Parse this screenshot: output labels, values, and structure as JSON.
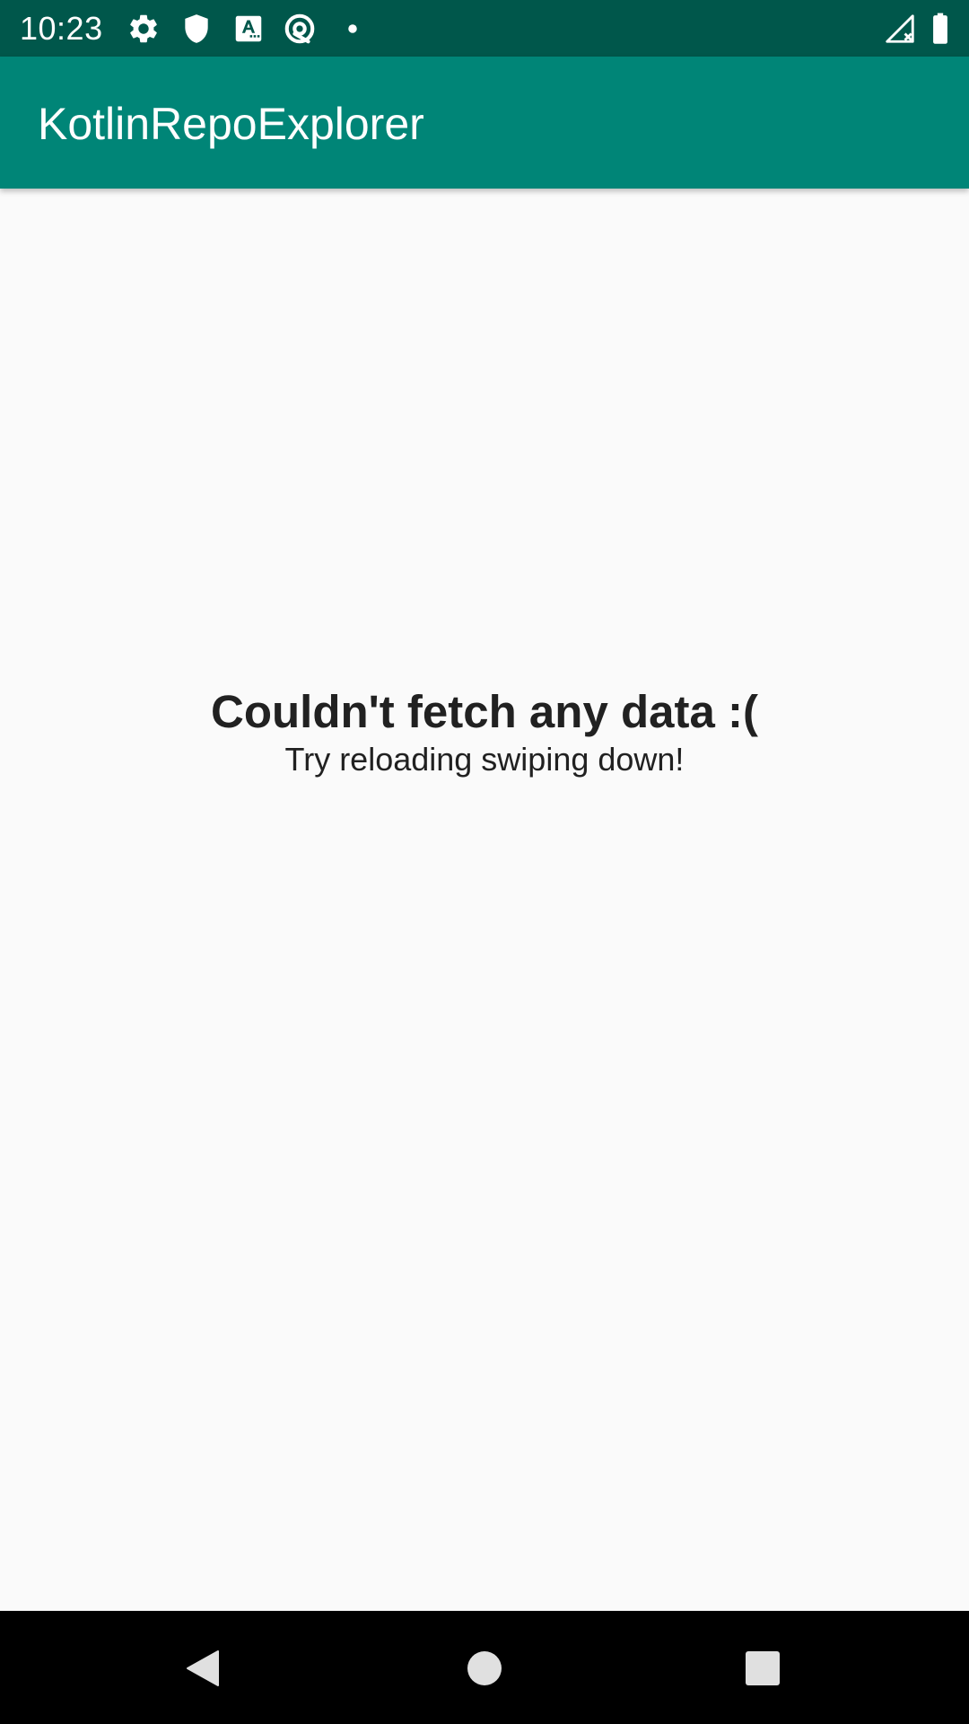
{
  "status_bar": {
    "time": "10:23",
    "icons": [
      "settings-gear-icon",
      "shield-icon",
      "a-text-icon",
      "circle-at-icon",
      "notification-dot-icon",
      "signal-no-service-icon",
      "battery-icon"
    ],
    "colors": {
      "background": "#00574B",
      "foreground": "#FFFFFF"
    }
  },
  "app_bar": {
    "title": "KotlinRepoExplorer",
    "colors": {
      "background": "#008577",
      "foreground": "#FFFFFF"
    }
  },
  "empty_state": {
    "title": "Couldn't fetch any data :(",
    "subtitle": "Try reloading swiping down!",
    "colors": {
      "text": "#212121",
      "background": "#FAFAFA"
    }
  },
  "navigation_bar": {
    "buttons": [
      "back-triangle-icon",
      "home-circle-icon",
      "recents-square-icon"
    ],
    "colors": {
      "background": "#000000",
      "icon": "#E0E0E0"
    }
  }
}
